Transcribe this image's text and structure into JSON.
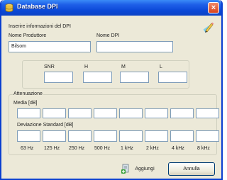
{
  "window": {
    "title": "Database DPI",
    "close_symbol": "×"
  },
  "header": {
    "instructions": "Inserire informazioni del DPI",
    "producer_label": "Nome Produttore",
    "producer_value": "Bilsom",
    "dpi_label": "Nome DPI",
    "dpi_value": ""
  },
  "ratings": {
    "labels": [
      "SNR",
      "H",
      "M",
      "L"
    ],
    "values": [
      "",
      "",
      "",
      ""
    ]
  },
  "attenuation": {
    "title": "Attenuazione",
    "mean_label": "Media [dB]",
    "std_label": "Deviazione Standard [dB]",
    "mean_values": [
      "",
      "",
      "",
      "",
      "",
      "",
      "",
      ""
    ],
    "std_values": [
      "",
      "",
      "",
      "",
      "",
      "",
      "",
      ""
    ],
    "frequencies": [
      "63 Hz",
      "125 Hz",
      "250 Hz",
      "500 Hz",
      "1 kHz",
      "2 kHz",
      "4 kHz",
      "8 kHz"
    ]
  },
  "buttons": {
    "add_label": "Aggiungi",
    "cancel_label": "Annulla"
  },
  "icons": {
    "app": "database-app-icon",
    "edit": "pencil-edit-icon",
    "add": "add-record-icon"
  },
  "colors": {
    "titlebar": "#0a47d6",
    "dialog_bg": "#ece9d8",
    "field_border": "#7f9db9"
  }
}
